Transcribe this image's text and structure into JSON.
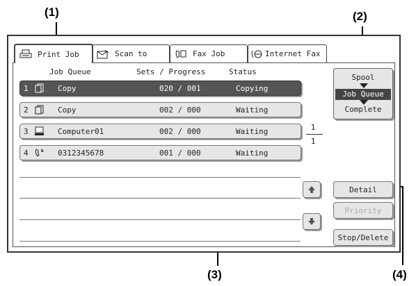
{
  "callouts": {
    "c1": "(1)",
    "c2": "(2)",
    "c3": "(3)",
    "c4": "(4)"
  },
  "tabs": [
    {
      "label": "Print Job",
      "icon": "printer-icon",
      "active": true
    },
    {
      "label": "Scan to",
      "icon": "scanner-icon",
      "active": false
    },
    {
      "label": "Fax Job",
      "icon": "fax-icon",
      "active": false
    },
    {
      "label": "Internet Fax",
      "icon": "internet-fax-icon",
      "active": false
    }
  ],
  "headers": {
    "queue": "Job Queue",
    "progress": "Sets / Progress",
    "status": "Status"
  },
  "rows": [
    {
      "num": "1",
      "icon": "copy-icon",
      "job": "Copy",
      "progress": "020 / 001",
      "status": "Copying",
      "selected": true
    },
    {
      "num": "2",
      "icon": "copy-icon",
      "job": "Copy",
      "progress": "002 / 000",
      "status": "Waiting",
      "selected": false
    },
    {
      "num": "3",
      "icon": "computer-icon",
      "job": "Computer01",
      "progress": "002 / 000",
      "status": "Waiting",
      "selected": false
    },
    {
      "num": "4",
      "icon": "fax-call-icon",
      "job": "0312345678",
      "progress": "001 / 000",
      "status": "Waiting",
      "selected": false
    }
  ],
  "pagination": {
    "current": "1",
    "total": "1"
  },
  "mode": {
    "spool": "Spool",
    "job_queue": "Job Queue",
    "complete": "Complete",
    "selected": "job_queue"
  },
  "buttons": {
    "detail": "Detail",
    "priority": "Priority",
    "stop_delete": "Stop/Delete"
  },
  "colors": {
    "selected_row": "#555555",
    "button_face": "#e6e6e6",
    "disabled_text": "#aaaaaa"
  }
}
